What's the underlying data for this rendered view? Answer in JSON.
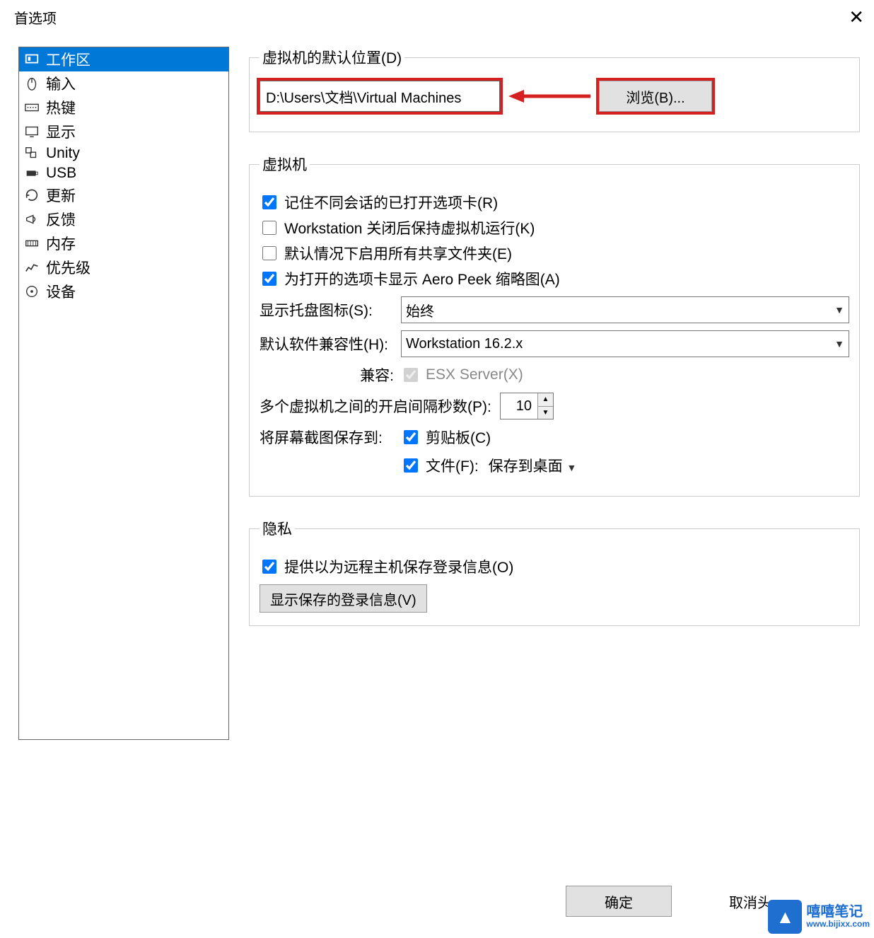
{
  "window": {
    "title": "首选项"
  },
  "sidebar": {
    "items": [
      {
        "label": "工作区",
        "icon": "workspace-icon",
        "selected": true
      },
      {
        "label": "输入",
        "icon": "mouse-icon"
      },
      {
        "label": "热键",
        "icon": "keyboard-icon"
      },
      {
        "label": "显示",
        "icon": "monitor-icon"
      },
      {
        "label": "Unity",
        "icon": "unity-icon"
      },
      {
        "label": "USB",
        "icon": "usb-icon"
      },
      {
        "label": "更新",
        "icon": "refresh-icon"
      },
      {
        "label": "反馈",
        "icon": "megaphone-icon"
      },
      {
        "label": "内存",
        "icon": "memory-icon"
      },
      {
        "label": "优先级",
        "icon": "priority-icon"
      },
      {
        "label": "设备",
        "icon": "device-icon"
      }
    ]
  },
  "groups": {
    "defaultLocation": {
      "legend": "虚拟机的默认位置(D)",
      "path": "D:\\Users\\文档\\Virtual Machines",
      "browse": "浏览(B)..."
    },
    "vm": {
      "legend": "虚拟机",
      "cb_remember": {
        "label": "记住不同会话的已打开选项卡(R)",
        "checked": true
      },
      "cb_keeprun": {
        "label": "Workstation 关闭后保持虚拟机运行(K)",
        "checked": false
      },
      "cb_shared": {
        "label": "默认情况下启用所有共享文件夹(E)",
        "checked": false
      },
      "cb_aero": {
        "label": "为打开的选项卡显示 Aero Peek 缩略图(A)",
        "checked": true
      },
      "tray_label": "显示托盘图标(S):",
      "tray_value": "始终",
      "compat_label": "默认软件兼容性(H):",
      "compat_value": "Workstation 16.2.x",
      "compat_with_label": "兼容:",
      "esx_label": "ESX Server(X)",
      "interval_label": "多个虚拟机之间的开启间隔秒数(P):",
      "interval_value": "10",
      "screenshot_label": "将屏幕截图保存到:",
      "clip_label": "剪贴板(C)",
      "file_label": "文件(F):",
      "file_value": "保存到桌面"
    },
    "privacy": {
      "legend": "隐私",
      "cb_save_login": {
        "label": "提供以为远程主机保存登录信息(O)",
        "checked": true
      },
      "show_saved_btn": "显示保存的登录信息(V)"
    }
  },
  "footer": {
    "ok": "确定",
    "cancel": "取消",
    "help_fragment": "头"
  },
  "watermark": {
    "brand": "嘻嘻笔记",
    "url": "www.bijixx.com"
  }
}
